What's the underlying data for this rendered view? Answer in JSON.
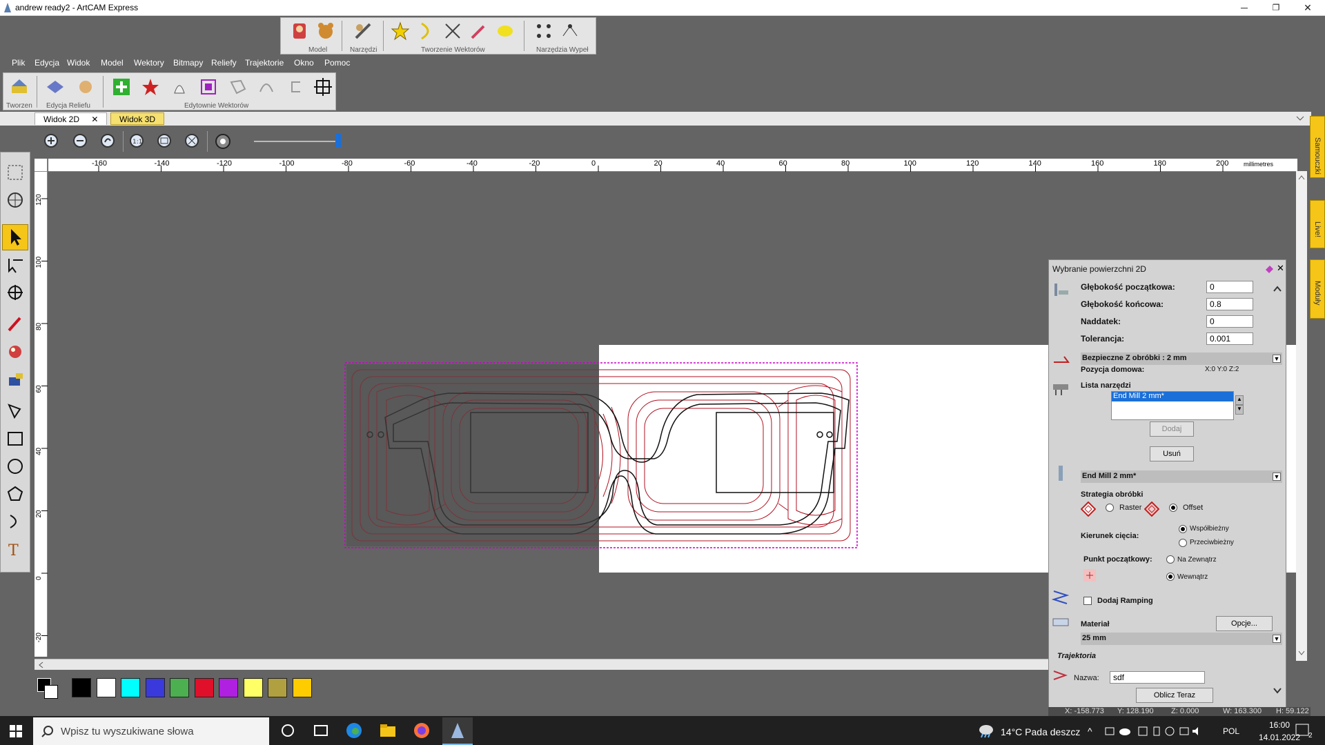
{
  "window": {
    "title": "andrew ready2 - ArtCAM Express",
    "minimize": "─",
    "maximize": "❐",
    "close": "✕"
  },
  "top_toolbar": {
    "groups": [
      "Model",
      "Narzędzi",
      "Tworzenie Wektorów",
      "Narzędzia Wypeł"
    ]
  },
  "menu": [
    "Plik",
    "Edycja",
    "Widok",
    "Model",
    "Wektory",
    "Bitmapy",
    "Reliefy",
    "Trajektorie",
    "Okno",
    "Pomoc"
  ],
  "second_toolbar": {
    "groups": [
      "Tworzen",
      "Edycja Reliefu",
      "Edytownie Wektorów"
    ]
  },
  "tabs": [
    {
      "label": "Widok 2D",
      "close": "✕",
      "active": true
    },
    {
      "label": "Widok 3D",
      "active": false
    }
  ],
  "ruler": {
    "h_ticks": [
      "-160",
      "-140",
      "-120",
      "-100",
      "-80",
      "-60",
      "-40",
      "-20",
      "0",
      "20",
      "40",
      "60",
      "80",
      "100",
      "120",
      "140",
      "160",
      "180",
      "200"
    ],
    "units": "millimetres",
    "v_ticks": [
      "120",
      "100",
      "80",
      "60",
      "40",
      "20",
      "0",
      "-20"
    ]
  },
  "side_tabs": [
    "Samouczki",
    "Live!",
    "Moduły"
  ],
  "panel": {
    "title": "Wybranie powierzchni 2D",
    "start_depth_label": "Głębokość początkowa:",
    "start_depth": "0",
    "end_depth_label": "Głębokość końcowa:",
    "end_depth": "0.8",
    "allowance_label": "Naddatek:",
    "allowance": "0",
    "tolerance_label": "Tolerancja:",
    "tolerance": "0.001",
    "safe_z": "Bezpieczne Z obróbki : 2 mm",
    "home_label": "Pozycja domowa:",
    "home_value": "X:0 Y:0 Z:2",
    "tool_list_label": "Lista narzędzi",
    "tool_list": [
      "End Mill 2 mm*"
    ],
    "add_button": "Dodaj",
    "remove_button": "Usuń",
    "selected_tool": "End Mill 2 mm*",
    "strategy_label": "Strategia obróbki",
    "strategy_raster": "Raster",
    "strategy_offset": "Offset",
    "strategy_selected": "Offset",
    "cut_dir_label": "Kierunek cięcia:",
    "cut_climb": "Współbieżny",
    "cut_conventional": "Przeciwbieżny",
    "cut_selected": "Współbieżny",
    "start_point_label": "Punkt początkowy:",
    "start_outside": "Na Zewnątrz",
    "start_inside": "Wewnątrz",
    "start_selected": "Wewnątrz",
    "ramping_label": "Dodaj Ramping",
    "ramping_checked": false,
    "material_label": "Materiał",
    "options_button": "Opcje...",
    "material_value": "25 mm",
    "toolpath_label": "Trajektoria",
    "name_label": "Nazwa:",
    "name_value": "sdf",
    "calc_button": "Oblicz Teraz"
  },
  "status": {
    "x": "X: -158.773",
    "y": "Y: 128.190",
    "z": "Z: 0.000",
    "w": "W: 163.300",
    "h": "H: 59.122"
  },
  "palette": {
    "colors": [
      "#000000",
      "#ffffff",
      "#00ffff",
      "#3a3adc",
      "#4caf50",
      "#e0102a",
      "#b020e0",
      "#ffff66",
      "#b0a040",
      "#ffcc00"
    ]
  },
  "taskbar": {
    "search_placeholder": "Wpisz tu wyszukiwane słowa",
    "weather": "14°C  Pada deszcz",
    "lang": "POL",
    "time": "16:00",
    "date": "14.01.2022",
    "notifications": "2"
  }
}
